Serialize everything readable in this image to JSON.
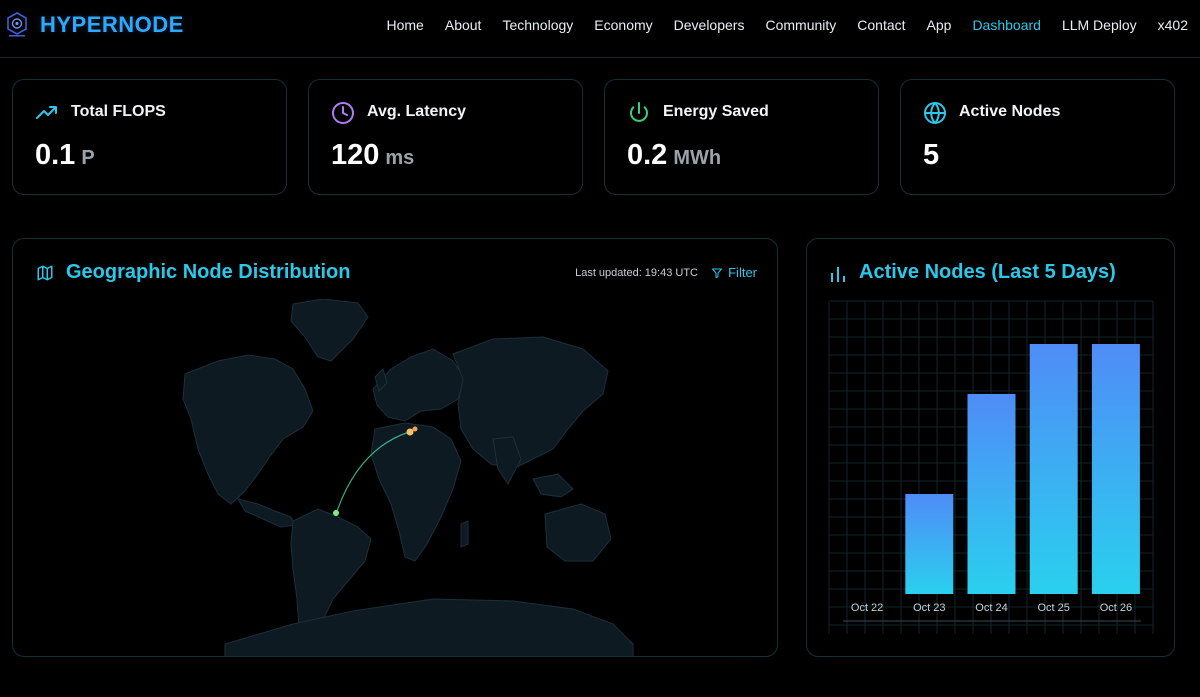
{
  "header": {
    "brand": "HYPERNODE",
    "nav": [
      {
        "label": "Home",
        "active": false
      },
      {
        "label": "About",
        "active": false
      },
      {
        "label": "Technology",
        "active": false
      },
      {
        "label": "Economy",
        "active": false
      },
      {
        "label": "Developers",
        "active": false
      },
      {
        "label": "Community",
        "active": false
      },
      {
        "label": "Contact",
        "active": false
      },
      {
        "label": "App",
        "active": false
      },
      {
        "label": "Dashboard",
        "active": true
      },
      {
        "label": "LLM Deploy",
        "active": false
      },
      {
        "label": "x402",
        "active": false
      }
    ]
  },
  "stats": [
    {
      "label": "Total FLOPS",
      "value": "0.1",
      "unit": "P",
      "icon": "trending-up-icon",
      "color": "#2ac8ea"
    },
    {
      "label": "Avg. Latency",
      "value": "120",
      "unit": "ms",
      "icon": "clock-icon",
      "color": "#b07cf5"
    },
    {
      "label": "Energy Saved",
      "value": "0.2",
      "unit": "MWh",
      "icon": "power-icon",
      "color": "#3ad07a"
    },
    {
      "label": "Active Nodes",
      "value": "5",
      "unit": "",
      "icon": "globe-icon",
      "color": "#2ac8ea"
    }
  ],
  "map": {
    "title": "Geographic Node Distribution",
    "updated": "Last updated: 19:43 UTC",
    "filter": "Filter"
  },
  "chart_data": {
    "type": "bar",
    "title": "Active Nodes (Last 5 Days)",
    "categories": [
      "Oct 22",
      "Oct 23",
      "Oct 24",
      "Oct 25",
      "Oct 26"
    ],
    "values": [
      0,
      2,
      4,
      5,
      5
    ],
    "ylim": [
      0,
      6
    ],
    "grid": true,
    "colors": {
      "top": "#4f8cf7",
      "bottom": "#2ad0ee"
    }
  },
  "colors": {
    "accent": "#2ac8ea",
    "brand": "#2ea8ff",
    "border": "#163036",
    "map_land": "#0e1a22"
  }
}
